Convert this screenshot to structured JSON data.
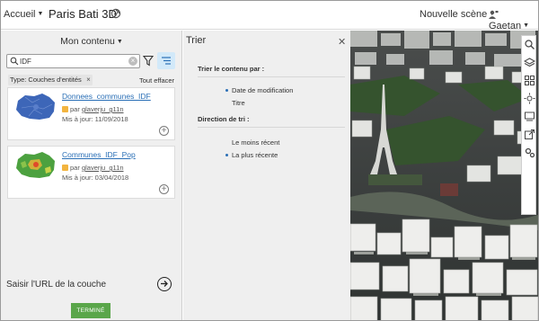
{
  "header": {
    "home_label": "Accueil",
    "scene_title": "Paris Bati 3D",
    "new_scene_label": "Nouvelle scène",
    "user_name": "Gaetan"
  },
  "left_panel": {
    "content_menu": "Mon contenu",
    "search_value": "IDF",
    "filter_chip": "Type: Couches d'entités",
    "clear_all": "Tout effacer",
    "items": [
      {
        "title": "Donnees_communes_IDF",
        "owner_prefix": "par",
        "owner": "glaverju_g11n",
        "updated": "Mis à jour: 11/09/2018"
      },
      {
        "title": "Communes_IDF_Pop",
        "owner_prefix": "par",
        "owner": "glaverju_g11n",
        "updated": "Mis à jour: 03/04/2018"
      }
    ],
    "url_label": "Saisir l'URL de la couche",
    "done_label": "TERMINÉ"
  },
  "sort_panel": {
    "title": "Trier",
    "sort_by_heading": "Trier le contenu par :",
    "sort_by_options": [
      "Date de modification",
      "Titre"
    ],
    "direction_heading": "Direction de tri :",
    "direction_options": [
      "Le moins récent",
      "La plus récente"
    ]
  },
  "colors": {
    "accent_blue": "#2a6fb6",
    "done_green": "#5aa64a",
    "sort_active": "#d2e9f9"
  },
  "icons": [
    "sync-icon",
    "user-icon",
    "search-icon",
    "filter-icon",
    "sort-icon",
    "close-icon",
    "add-icon",
    "arrow-right-icon",
    "layers-icon",
    "basemap-icon",
    "daylight-icon",
    "slides-icon",
    "share-icon",
    "settings-icon"
  ]
}
